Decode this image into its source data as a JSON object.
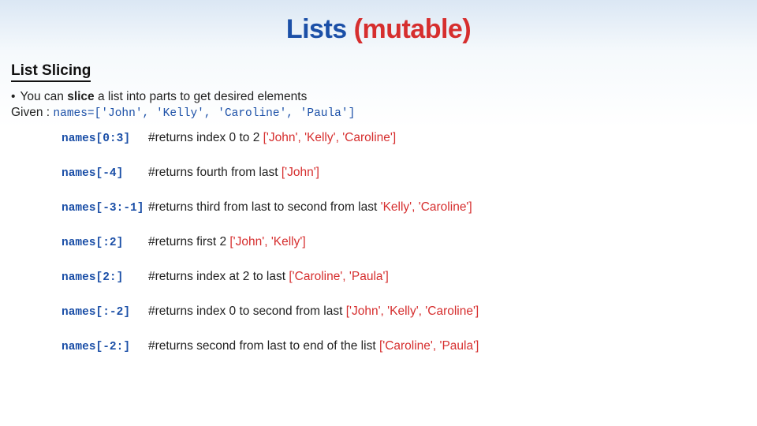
{
  "title": {
    "word1": "Lists ",
    "word2": "(mutable)"
  },
  "subhead": "List Slicing",
  "intro": {
    "bullet": "•",
    "pre": "You can ",
    "strong": "slice",
    "post": " a list into parts to get desired elements"
  },
  "given": {
    "label": "Given : ",
    "code": "names=['John', 'Kelly', 'Caroline', 'Paula']"
  },
  "examples": [
    {
      "code": "names[0:3]",
      "desc": "#returns index 0 to 2 ",
      "result": "['John', 'Kelly', 'Caroline']"
    },
    {
      "code": "names[-4]",
      "desc": "#returns fourth from last ",
      "result": "['John']"
    },
    {
      "code": "names[-3:-1]",
      "desc": "#returns third from last to second from last ",
      "result": "'Kelly', 'Caroline']"
    },
    {
      "code": "names[:2]",
      "desc": "#returns first 2 ",
      "result": "['John', 'Kelly']"
    },
    {
      "code": "names[2:]",
      "desc": "#returns index at 2 to last ",
      "result": "['Caroline', 'Paula']"
    },
    {
      "code": "names[:-2]",
      "desc": "#returns index 0 to second from last ",
      "result": "['John', 'Kelly', 'Caroline']"
    },
    {
      "code": "names[-2:]",
      "desc": "#returns second from last to end of the list ",
      "result": "['Caroline', 'Paula']"
    }
  ]
}
